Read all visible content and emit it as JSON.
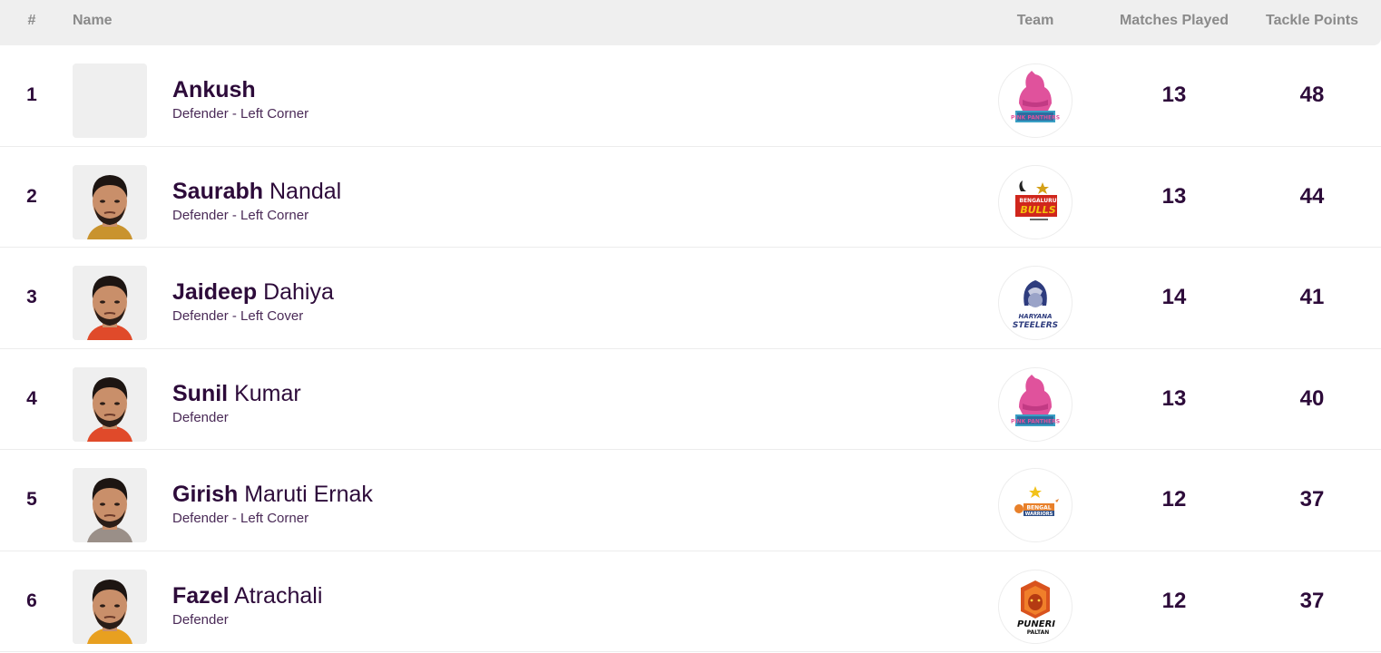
{
  "header": {
    "rank": "#",
    "name": "Name",
    "team": "Team",
    "matches_played": "Matches Played",
    "tackle_points": "Tackle Points"
  },
  "colors": {
    "text_primary": "#2d0b3a",
    "header_bg": "#efefef",
    "header_text": "#8a8a8a"
  },
  "rows": [
    {
      "rank": "1",
      "first_name": "Ankush",
      "last_name": "",
      "position": "Defender - Left Corner",
      "team": "Jaipur Pink Panthers",
      "team_logo": "pink-panthers-logo",
      "photo": "placeholder",
      "matches_played": "13",
      "tackle_points": "48"
    },
    {
      "rank": "2",
      "first_name": "Saurabh",
      "last_name": "Nandal",
      "position": "Defender - Left Corner",
      "team": "Bengaluru Bulls",
      "team_logo": "bengaluru-bulls-logo",
      "photo": "player-photo",
      "matches_played": "13",
      "tackle_points": "44"
    },
    {
      "rank": "3",
      "first_name": "Jaideep",
      "last_name": "Dahiya",
      "position": "Defender - Left Cover",
      "team": "Haryana Steelers",
      "team_logo": "haryana-steelers-logo",
      "photo": "player-photo",
      "matches_played": "14",
      "tackle_points": "41"
    },
    {
      "rank": "4",
      "first_name": "Sunil",
      "last_name": "Kumar",
      "position": "Defender",
      "team": "Jaipur Pink Panthers",
      "team_logo": "pink-panthers-logo",
      "photo": "player-photo",
      "matches_played": "13",
      "tackle_points": "40"
    },
    {
      "rank": "5",
      "first_name": "Girish",
      "last_name": "Maruti Ernak",
      "position": "Defender - Left Corner",
      "team": "Bengal Warriors",
      "team_logo": "bengal-warriors-logo",
      "photo": "player-photo",
      "matches_played": "12",
      "tackle_points": "37"
    },
    {
      "rank": "6",
      "first_name": "Fazel",
      "last_name": "Atrachali",
      "position": "Defender",
      "team": "Puneri Paltan",
      "team_logo": "puneri-paltan-logo",
      "photo": "player-photo",
      "matches_played": "12",
      "tackle_points": "37"
    }
  ]
}
